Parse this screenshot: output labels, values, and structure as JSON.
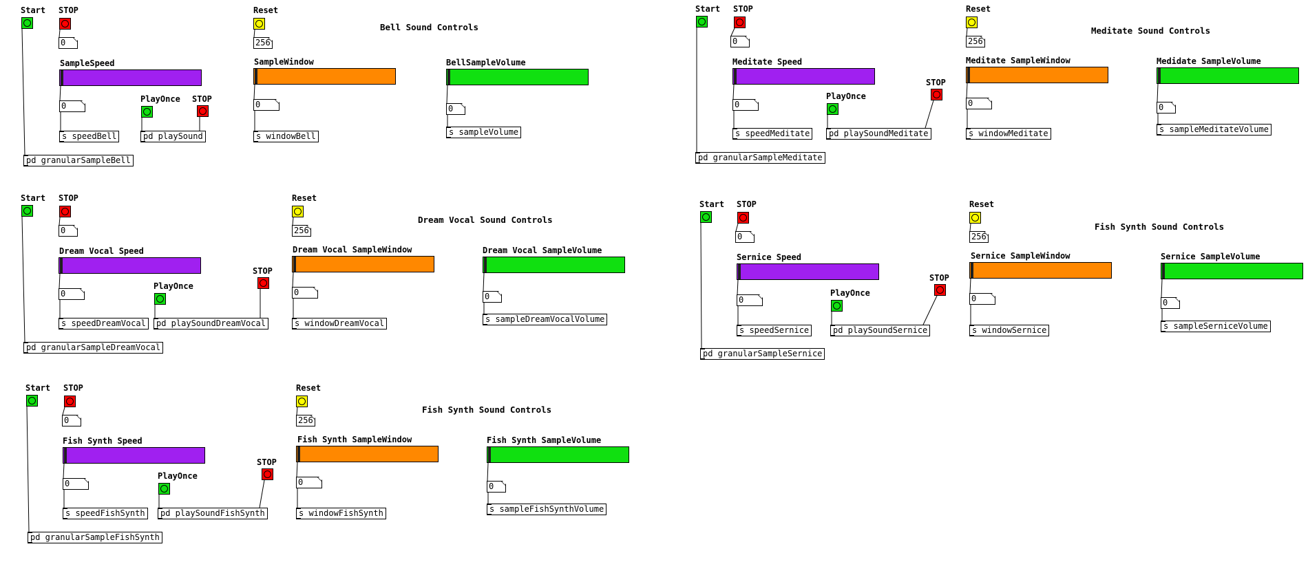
{
  "colors": {
    "start": "#10e010",
    "stop": "#ff0000",
    "reset": "#ffff00",
    "speed": "#a020f0",
    "window": "#ff8800",
    "volume": "#10e010"
  },
  "panels": [
    {
      "title": "Bell Sound Controls",
      "start_label": "Start",
      "stop_label": "STOP",
      "stop_value": "0",
      "speed_label": "SampleSpeed",
      "speed_value": "0",
      "speed_send": "s speedBell",
      "play_label": "PlayOnce",
      "play_stop_label": "STOP",
      "play_object": "pd playSound",
      "granular_object": "pd granularSampleBell",
      "reset_label": "Reset",
      "reset_value": "256",
      "window_label": "SampleWindow",
      "window_value": "0",
      "window_send": "s windowBell",
      "volume_label": "BellSampleVolume",
      "volume_value": "0",
      "volume_send": "s sampleVolume"
    },
    {
      "title": "Meditate Sound Controls",
      "start_label": "Start",
      "stop_label": "STOP",
      "stop_value": "0",
      "speed_label": "Meditate Speed",
      "speed_value": "0",
      "speed_send": "s speedMeditate",
      "play_label": "PlayOnce",
      "play_stop_label": "STOP",
      "play_object": "pd playSoundMeditate",
      "granular_object": "pd granularSampleMeditate",
      "reset_label": "Reset",
      "reset_value": "256",
      "window_label": "Meditate SampleWindow",
      "window_value": "0",
      "window_send": "s windowMeditate",
      "volume_label": "Medidate SampleVolume",
      "volume_value": "0",
      "volume_send": "s sampleMeditateVolume"
    },
    {
      "title": "Dream Vocal Sound Controls",
      "start_label": "Start",
      "stop_label": "STOP",
      "stop_value": "0",
      "speed_label": "Dream Vocal Speed",
      "speed_value": "0",
      "speed_send": "s speedDreamVocal",
      "play_label": "PlayOnce",
      "play_stop_label": "STOP",
      "play_object": "pd playSoundDreamVocal",
      "granular_object": "pd granularSampleDreamVocal",
      "reset_label": "Reset",
      "reset_value": "256",
      "window_label": "Dream Vocal SampleWindow",
      "window_value": "0",
      "window_send": "s windowDreamVocal",
      "volume_label": "Dream Vocal SampleVolume",
      "volume_value": "0",
      "volume_send": "s sampleDreamVocalVolume"
    },
    {
      "title": "Fish Synth Sound Controls",
      "start_label": "Start",
      "stop_label": "STOP",
      "stop_value": "0",
      "speed_label": "Sernice Speed",
      "speed_value": "0",
      "speed_send": "s speedSernice",
      "play_label": "PlayOnce",
      "play_stop_label": "STOP",
      "play_object": "pd playSoundSernice",
      "granular_object": "pd granularSampleSernice",
      "reset_label": "Reset",
      "reset_value": "256",
      "window_label": "Sernice SampleWindow",
      "window_value": "0",
      "window_send": "s windowSernice",
      "volume_label": "Sernice SampleVolume",
      "volume_value": "0",
      "volume_send": "s sampleSerniceVolume"
    },
    {
      "title": "Fish Synth Sound Controls",
      "start_label": "Start",
      "stop_label": "STOP",
      "stop_value": "0",
      "speed_label": "Fish Synth Speed",
      "speed_value": "0",
      "speed_send": "s speedFishSynth",
      "play_label": "PlayOnce",
      "play_stop_label": "STOP",
      "play_object": "pd playSoundFishSynth",
      "granular_object": "pd granularSampleFishSynth",
      "reset_label": "Reset",
      "reset_value": "256",
      "window_label": "Fish Synth SampleWindow",
      "window_value": "0",
      "window_send": "s windowFishSynth",
      "volume_label": "Fish Synth SampleVolume",
      "volume_value": "0",
      "volume_send": "s sampleFishSynthVolume"
    }
  ]
}
